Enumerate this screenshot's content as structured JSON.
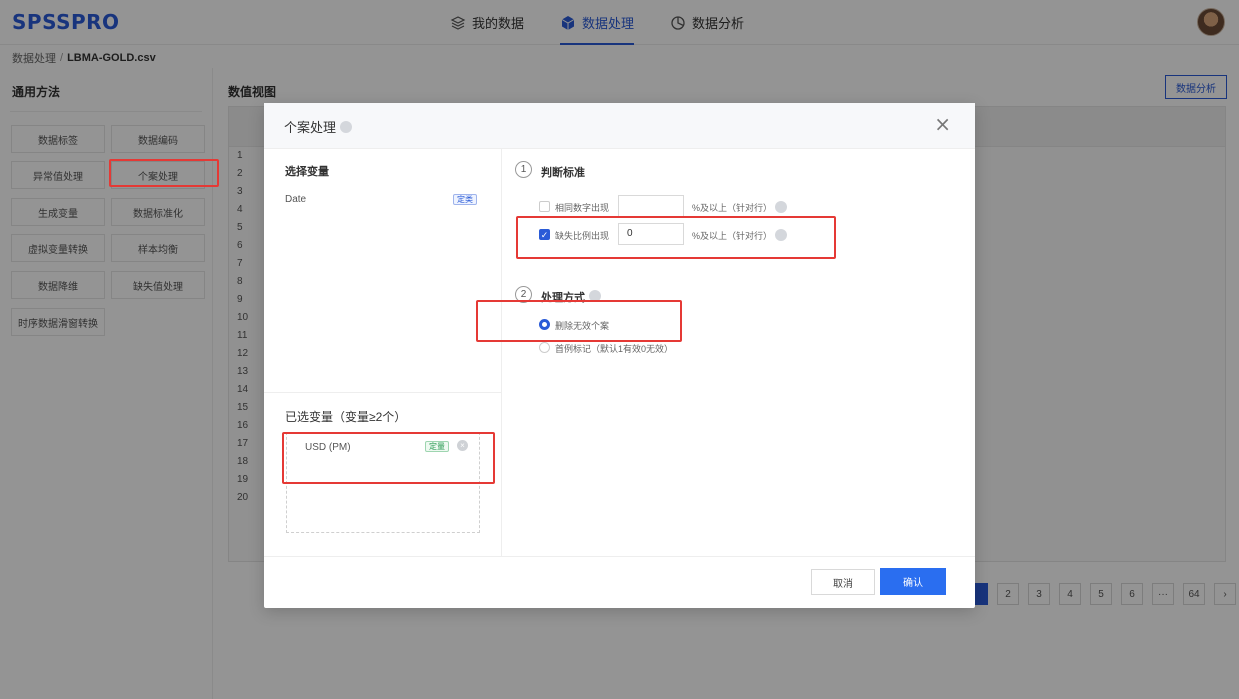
{
  "app": {
    "logo": "SPSSPRO"
  },
  "nav": [
    {
      "label": "我的数据",
      "icon": "layers-icon",
      "active": false
    },
    {
      "label": "数据处理",
      "icon": "cube-icon",
      "active": true
    },
    {
      "label": "数据分析",
      "icon": "pie-chart-icon",
      "active": false
    }
  ],
  "breadcrumb": {
    "parent": "数据处理",
    "separator": "/",
    "current": "LBMA-GOLD.csv"
  },
  "left": {
    "title": "通用方法",
    "methods": [
      "数据标签",
      "数据编码",
      "异常值处理",
      "个案处理",
      "生成变量",
      "数据标准化",
      "虚拟变量转换",
      "样本均衡",
      "数据降维",
      "缺失值处理",
      "时序数据滑窗转换"
    ]
  },
  "main": {
    "title": "数值视图",
    "analysis_button": "数据分析",
    "row_numbers": [
      "1",
      "2",
      "3",
      "4",
      "5",
      "6",
      "7",
      "8",
      "9",
      "10",
      "11",
      "12",
      "13",
      "14",
      "15",
      "16",
      "17",
      "18",
      "19",
      "20"
    ],
    "pagination": [
      "2",
      "3",
      "4",
      "5",
      "6",
      "···",
      "64",
      "›"
    ]
  },
  "modal": {
    "title": "个案处理",
    "close": "×",
    "select_vars_label": "选择变量",
    "available_vars": [
      {
        "name": "Date",
        "tag": "定类"
      }
    ],
    "selected_label": "已选变量（变量≥2个）",
    "selected_vars": [
      {
        "name": "USD (PM)",
        "tag": "定量"
      }
    ],
    "criteria": {
      "step": "1",
      "title": "判断标准",
      "options": [
        {
          "label": "相同数字出现",
          "value": "",
          "suffix": "%及以上（针对行）",
          "checked": false
        },
        {
          "label": "缺失比例出现",
          "value": "0",
          "suffix": "%及以上（针对行）",
          "checked": true
        }
      ]
    },
    "method": {
      "step": "2",
      "title": "处理方式",
      "options": [
        {
          "label": "删除无效个案",
          "selected": true
        },
        {
          "label": "首例标记（默认1有效0无效）",
          "selected": false
        }
      ]
    },
    "cancel": "取消",
    "ok": "确认"
  },
  "colors": {
    "accent": "#2a5bd7",
    "highlight": "#e53935",
    "tag_green": "#2e9c56"
  }
}
